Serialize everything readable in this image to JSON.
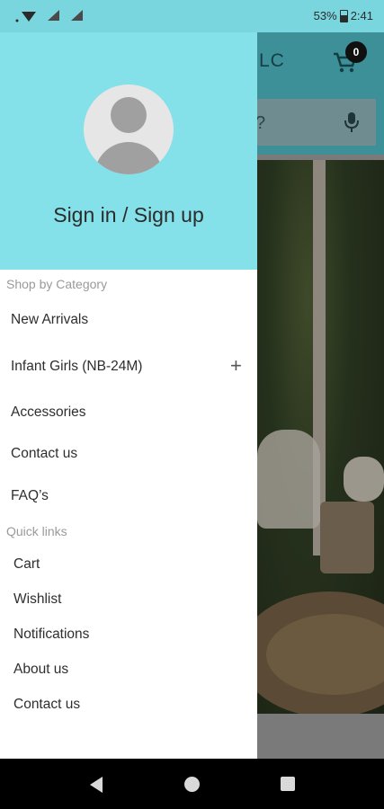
{
  "status_bar": {
    "battery_percent": "53%",
    "time": "2:41"
  },
  "app": {
    "title_fragment": "LC",
    "cart_count": "0",
    "search_fragment": "?"
  },
  "drawer": {
    "sign_in_label": "Sign in / Sign up",
    "shop_section_label": "Shop by Category",
    "categories": [
      {
        "label": "New Arrivals"
      },
      {
        "label": "Infant Girls (NB-24M)",
        "expand_icon": "+"
      },
      {
        "label": "Accessories"
      },
      {
        "label": "Contact us"
      },
      {
        "label": "FAQ’s"
      }
    ],
    "quick_links_label": "Quick links",
    "quick_links": [
      {
        "label": "Cart"
      },
      {
        "label": "Wishlist"
      },
      {
        "label": "Notifications"
      },
      {
        "label": "About us"
      },
      {
        "label": "Contact us"
      }
    ]
  },
  "icons": {
    "wifi": "wifi-icon",
    "signal": "signal-icon",
    "battery": "battery-icon",
    "cart": "cart-icon",
    "mic": "mic-icon",
    "avatar": "avatar-icon",
    "back": "back-icon",
    "home": "home-icon",
    "recents": "recents-icon"
  },
  "colors": {
    "drawer_header": "#84e0e9",
    "status_bar": "#79d6df",
    "scrim_app_header": "#3d8f98"
  }
}
